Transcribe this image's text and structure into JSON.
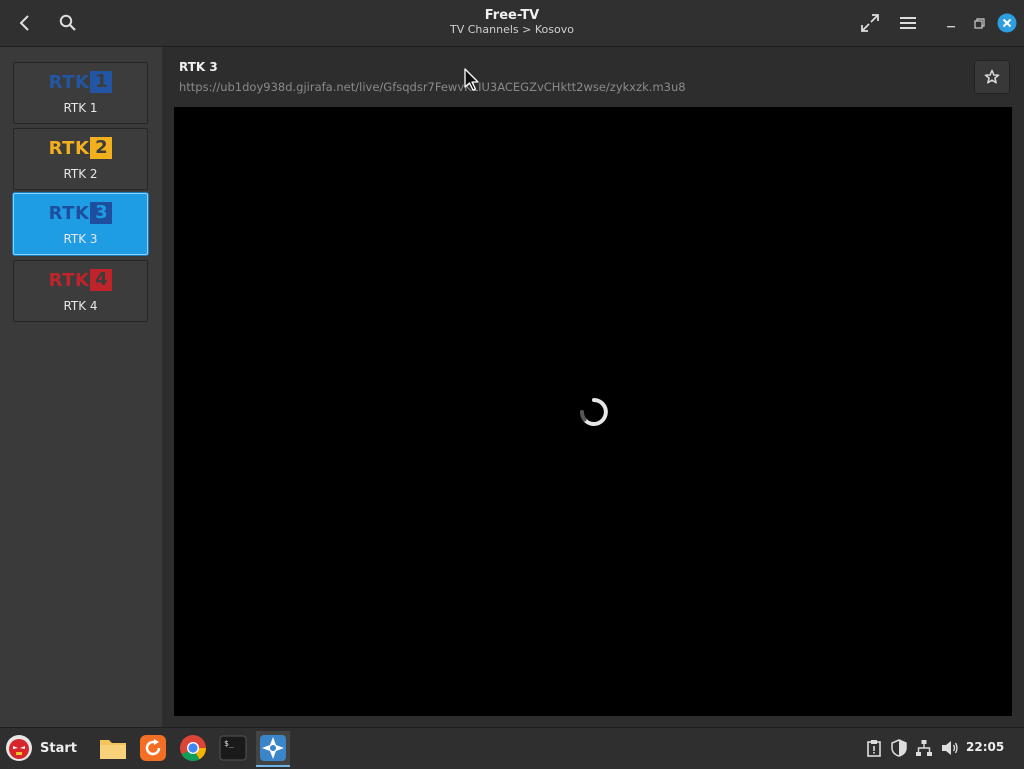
{
  "app": {
    "title": "Free-TV",
    "subtitle": "TV Channels > Kosovo"
  },
  "channels": [
    {
      "logo_text": "RTK",
      "logo_num": "1",
      "label": "RTK 1",
      "color": "#2255a4",
      "selected": false
    },
    {
      "logo_text": "RTK",
      "logo_num": "2",
      "label": "RTK 2",
      "color": "#f2b01e",
      "selected": false
    },
    {
      "logo_text": "RTK",
      "logo_num": "3",
      "label": "RTK 3",
      "color": "#1d4f9e",
      "selected": true
    },
    {
      "logo_text": "RTK",
      "logo_num": "4",
      "label": "RTK 4",
      "color": "#c0242b",
      "selected": false
    }
  ],
  "stream": {
    "title": "RTK 3",
    "url": "https://ub1doy938d.gjirafa.net/live/Gfsqdsr7FewvKLIU3ACEGZvCHktt2wse/zykxzk.m3u8"
  },
  "taskbar": {
    "start_label": "Start",
    "clock": "22:05"
  },
  "colors": {
    "accent": "#1e9de4",
    "close_button": "#2d9fe0"
  }
}
